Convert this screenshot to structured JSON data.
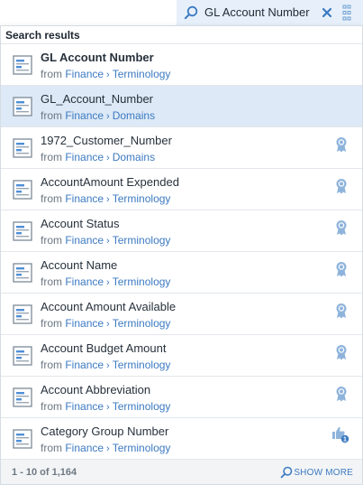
{
  "search": {
    "query": "GL Account Number"
  },
  "panel": {
    "header": "Search results",
    "from_label": "from",
    "results": [
      {
        "name": "GL Account Number",
        "path": [
          "Finance",
          "Terminology"
        ],
        "bold": true,
        "badge": "none"
      },
      {
        "name": "GL_Account_Number",
        "path": [
          "Finance",
          "Domains"
        ],
        "bold": false,
        "badge": "none",
        "selected": true
      },
      {
        "name": "1972_Customer_Number",
        "path": [
          "Finance",
          "Domains"
        ],
        "bold": false,
        "badge": "award"
      },
      {
        "name": "AccountAmount Expended",
        "path": [
          "Finance",
          "Terminology"
        ],
        "bold": false,
        "badge": "award"
      },
      {
        "name": "Account Status",
        "path": [
          "Finance",
          "Terminology"
        ],
        "bold": false,
        "badge": "award"
      },
      {
        "name": "Account Name",
        "path": [
          "Finance",
          "Terminology"
        ],
        "bold": false,
        "badge": "award"
      },
      {
        "name": "Account Amount Available",
        "path": [
          "Finance",
          "Terminology"
        ],
        "bold": false,
        "badge": "award"
      },
      {
        "name": "Account Budget Amount",
        "path": [
          "Finance",
          "Terminology"
        ],
        "bold": false,
        "badge": "award"
      },
      {
        "name": "Account Abbreviation",
        "path": [
          "Finance",
          "Terminology"
        ],
        "bold": false,
        "badge": "award"
      },
      {
        "name": "Category Group Number",
        "path": [
          "Finance",
          "Terminology"
        ],
        "bold": false,
        "badge": "thumbs-up",
        "badge_count": "1"
      }
    ],
    "footer": {
      "count": "1 - 10 of 1,164",
      "show_more": "SHOW MORE"
    }
  },
  "icons": {
    "search": "search-icon",
    "clear": "close-icon",
    "filter": "filter-icon",
    "document": "document-icon",
    "award": "award-ribbon-icon",
    "thumbs_up": "thumbs-up-icon"
  },
  "colors": {
    "accent": "#3c7ac2",
    "selected_row": "#dde9f6",
    "search_bg": "#e7f0fa",
    "award": "#8fb4dc"
  }
}
